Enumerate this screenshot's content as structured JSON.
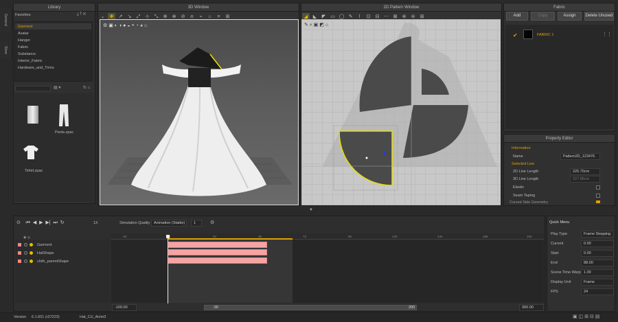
{
  "sidebar_tabs": {
    "general": "General",
    "store": "Store"
  },
  "library": {
    "title": "Library",
    "favorites_label": "Favorites",
    "favorites": [
      "Garment",
      "Avatar",
      "Hanger",
      "Fabric",
      "Substance",
      "Interior_Fabric",
      "Hardware_and_Trims"
    ],
    "selected_favorite": "Garment",
    "files": [
      {
        "name": ""
      },
      {
        "name": "Pants.zpac"
      },
      {
        "name": "Tshirt.zpac"
      }
    ]
  },
  "window3d": {
    "title": "3D Window"
  },
  "window2d": {
    "title": "2D Pattern Window"
  },
  "fabric": {
    "title": "Fabric",
    "buttons": {
      "add": "Add",
      "copy": "Copy",
      "assign": "Assign",
      "delete_unused": "Delete Unused"
    },
    "items": [
      {
        "name": "FABRIC 1"
      }
    ]
  },
  "property_editor": {
    "title": "Property Editor",
    "section_info": "Information",
    "name_label": "Name",
    "name_value": "Pattern2D_123476",
    "section_line": "Selected Line",
    "len2d_label": "2D Line Length",
    "len2d_value": "225.70cm",
    "len3d_label": "3D Line Length",
    "len3d_value": "227.88cm",
    "elastic_label": "Elastic",
    "seam_label": "Seam Taping",
    "curved_label": "Curved Side Geometry"
  },
  "timeline": {
    "sim_quality_label": "Simulation Quality",
    "sim_quality_value": "Animation (Stable)",
    "step_value": "1",
    "speed_label": "1X",
    "ruler": [
      "-24",
      "0",
      "24",
      "48",
      "72",
      "96",
      "120",
      "144",
      "168",
      "192"
    ],
    "tracks": [
      {
        "name": "Garment"
      },
      {
        "name": "HatShape"
      },
      {
        "name": "cloth_parentShape"
      }
    ],
    "range_start": "-100.00",
    "scroll_start": "-30",
    "scroll_end": "200",
    "range_end": "300.00"
  },
  "quick_menu": {
    "title": "Quick Menu",
    "rows": [
      {
        "label": "Play Type",
        "value": "Frame Stepping"
      },
      {
        "label": "Current",
        "value": "0.00"
      },
      {
        "label": "Start",
        "value": "0.00"
      },
      {
        "label": "End",
        "value": "88.00"
      },
      {
        "label": "Scene Time Warp",
        "value": "1.00"
      },
      {
        "label": "Display Unit",
        "value": "Frame"
      },
      {
        "label": "FPS",
        "value": "24"
      }
    ]
  },
  "status": {
    "version_label": "Version",
    "version_value": "6.1.601 (r37223)",
    "file_name": "Hat_CU_Anim3"
  },
  "colors": {
    "accent": "#e0a000",
    "selected_line": "#e8e000",
    "track_bar": "#f5a3a3"
  }
}
